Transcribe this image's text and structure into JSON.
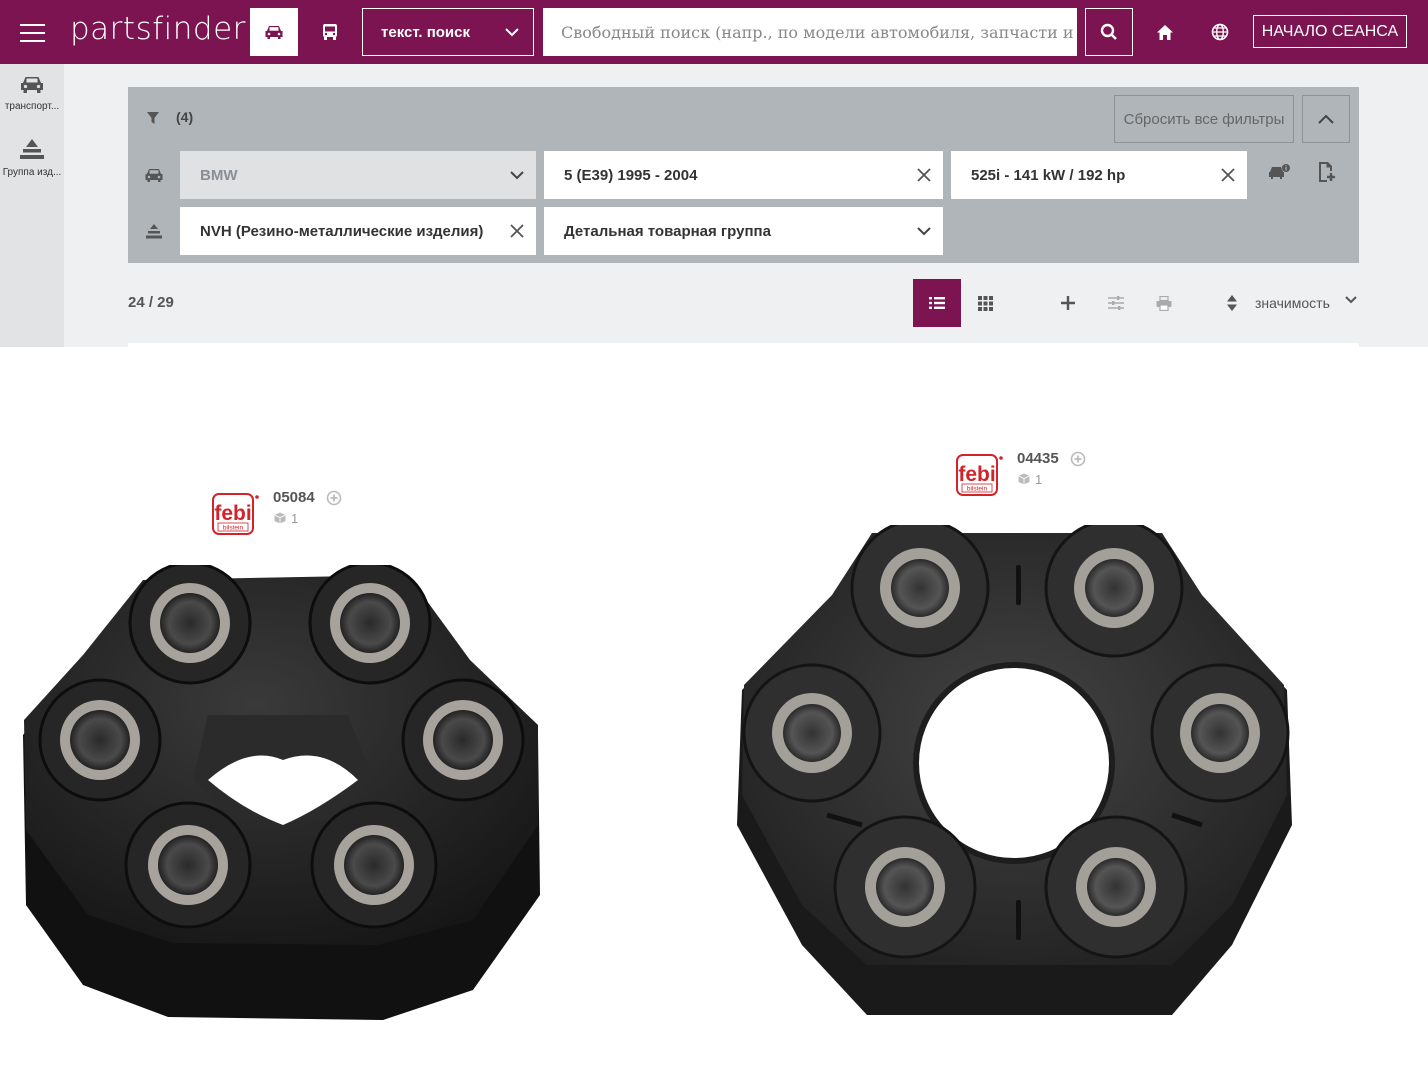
{
  "header": {
    "logo": "partsfinder",
    "search_mode": "текст. поиск",
    "search_placeholder": "Свободный поиск (напр., по модели автомобиля, запчасти и (или)",
    "session_button": "НАЧАЛО СЕАНСА"
  },
  "sidebar": {
    "items": [
      {
        "label": "транспорт...",
        "icon": "car-icon"
      },
      {
        "label": "Группа изд...",
        "icon": "product-group-icon"
      }
    ]
  },
  "filters": {
    "count": "(4)",
    "reset_label": "Сбросить все фильтры",
    "vehicle": {
      "make": "BMW",
      "model": "5 (E39) 1995 - 2004",
      "engine": "525i - 141 kW / 192 hp"
    },
    "product": {
      "group": "NVH (Резино-металлические изделия)",
      "detail_group": "Детальная товарная группа"
    }
  },
  "results": {
    "count": "24 / 29",
    "sort_label": "значимость"
  },
  "products": [
    {
      "brand": "febi bilstein",
      "article": "05084",
      "qty": "1"
    },
    {
      "brand": "febi bilstein",
      "article": "04435",
      "qty": "1"
    }
  ],
  "colors": {
    "brand": "#7b1450",
    "panel": "#b0b5b9",
    "febi_red": "#d2232a"
  }
}
